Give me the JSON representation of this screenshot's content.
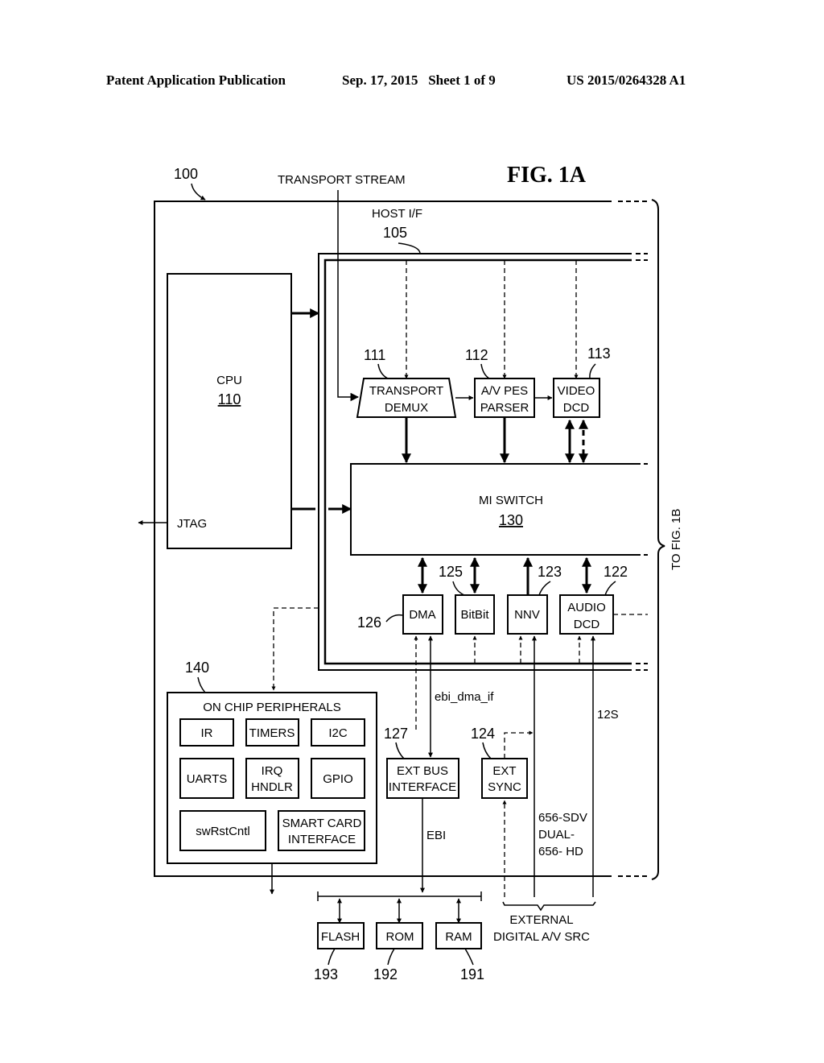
{
  "header": {
    "publication": "Patent Application Publication",
    "date_sheet": "Sep. 17, 2015   Sheet 1 of 9",
    "number": "US 2015/0264328 A1"
  },
  "figure": {
    "title": "FIG. 1A",
    "ref_system": "100",
    "transport_stream": "TRANSPORT STREAM",
    "host_if": "HOST I/F",
    "host_if_ref": "105",
    "to_fig": "TO FIG. 1B",
    "cpu": {
      "label": "CPU",
      "ref": "110",
      "jtag": "JTAG"
    },
    "transport_demux": {
      "line1": "TRANSPORT",
      "line2": "DEMUX",
      "ref": "111"
    },
    "av_pes_parser": {
      "line1": "A/V PES",
      "line2": "PARSER",
      "ref": "112"
    },
    "video_dcd": {
      "line1": "VIDEO",
      "line2": "DCD",
      "ref": "113"
    },
    "mi_switch": {
      "label": "MI SWITCH",
      "ref": "130"
    },
    "dma": {
      "label": "DMA",
      "ref": "126"
    },
    "bitbit": {
      "label": "BitBit",
      "ref": "125"
    },
    "nnv": {
      "label": "NNV",
      "ref": "123"
    },
    "audio_dcd": {
      "line1": "AUDIO",
      "line2": "DCD",
      "ref": "122"
    },
    "peripherals": {
      "ref": "140",
      "title": "ON CHIP PERIPHERALS",
      "ir": "IR",
      "timers": "TIMERS",
      "i2c": "I2C",
      "uarts": "UARTS",
      "irq1": "IRQ",
      "irq2": "HNDLR",
      "gpio": "GPIO",
      "swrst": "swRstCntl",
      "smart1": "SMART CARD",
      "smart2": "INTERFACE"
    },
    "ebi_dma_if": "ebi_dma_if",
    "ext_bus": {
      "line1": "EXT BUS",
      "line2": "INTERFACE",
      "ref": "127"
    },
    "ext_sync": {
      "line1": "EXT",
      "line2": "SYNC",
      "ref": "124"
    },
    "ebi": "EBI",
    "i2s": "12S",
    "video_signals": {
      "line1": "656-SDV",
      "line2": "DUAL-",
      "line3": "656- HD"
    },
    "external_src": {
      "line1": "EXTERNAL",
      "line2": "DIGITAL A/V SRC"
    },
    "flash": {
      "label": "FLASH",
      "ref": "193"
    },
    "rom": {
      "label": "ROM",
      "ref": "192"
    },
    "ram": {
      "label": "RAM",
      "ref": "191"
    }
  }
}
